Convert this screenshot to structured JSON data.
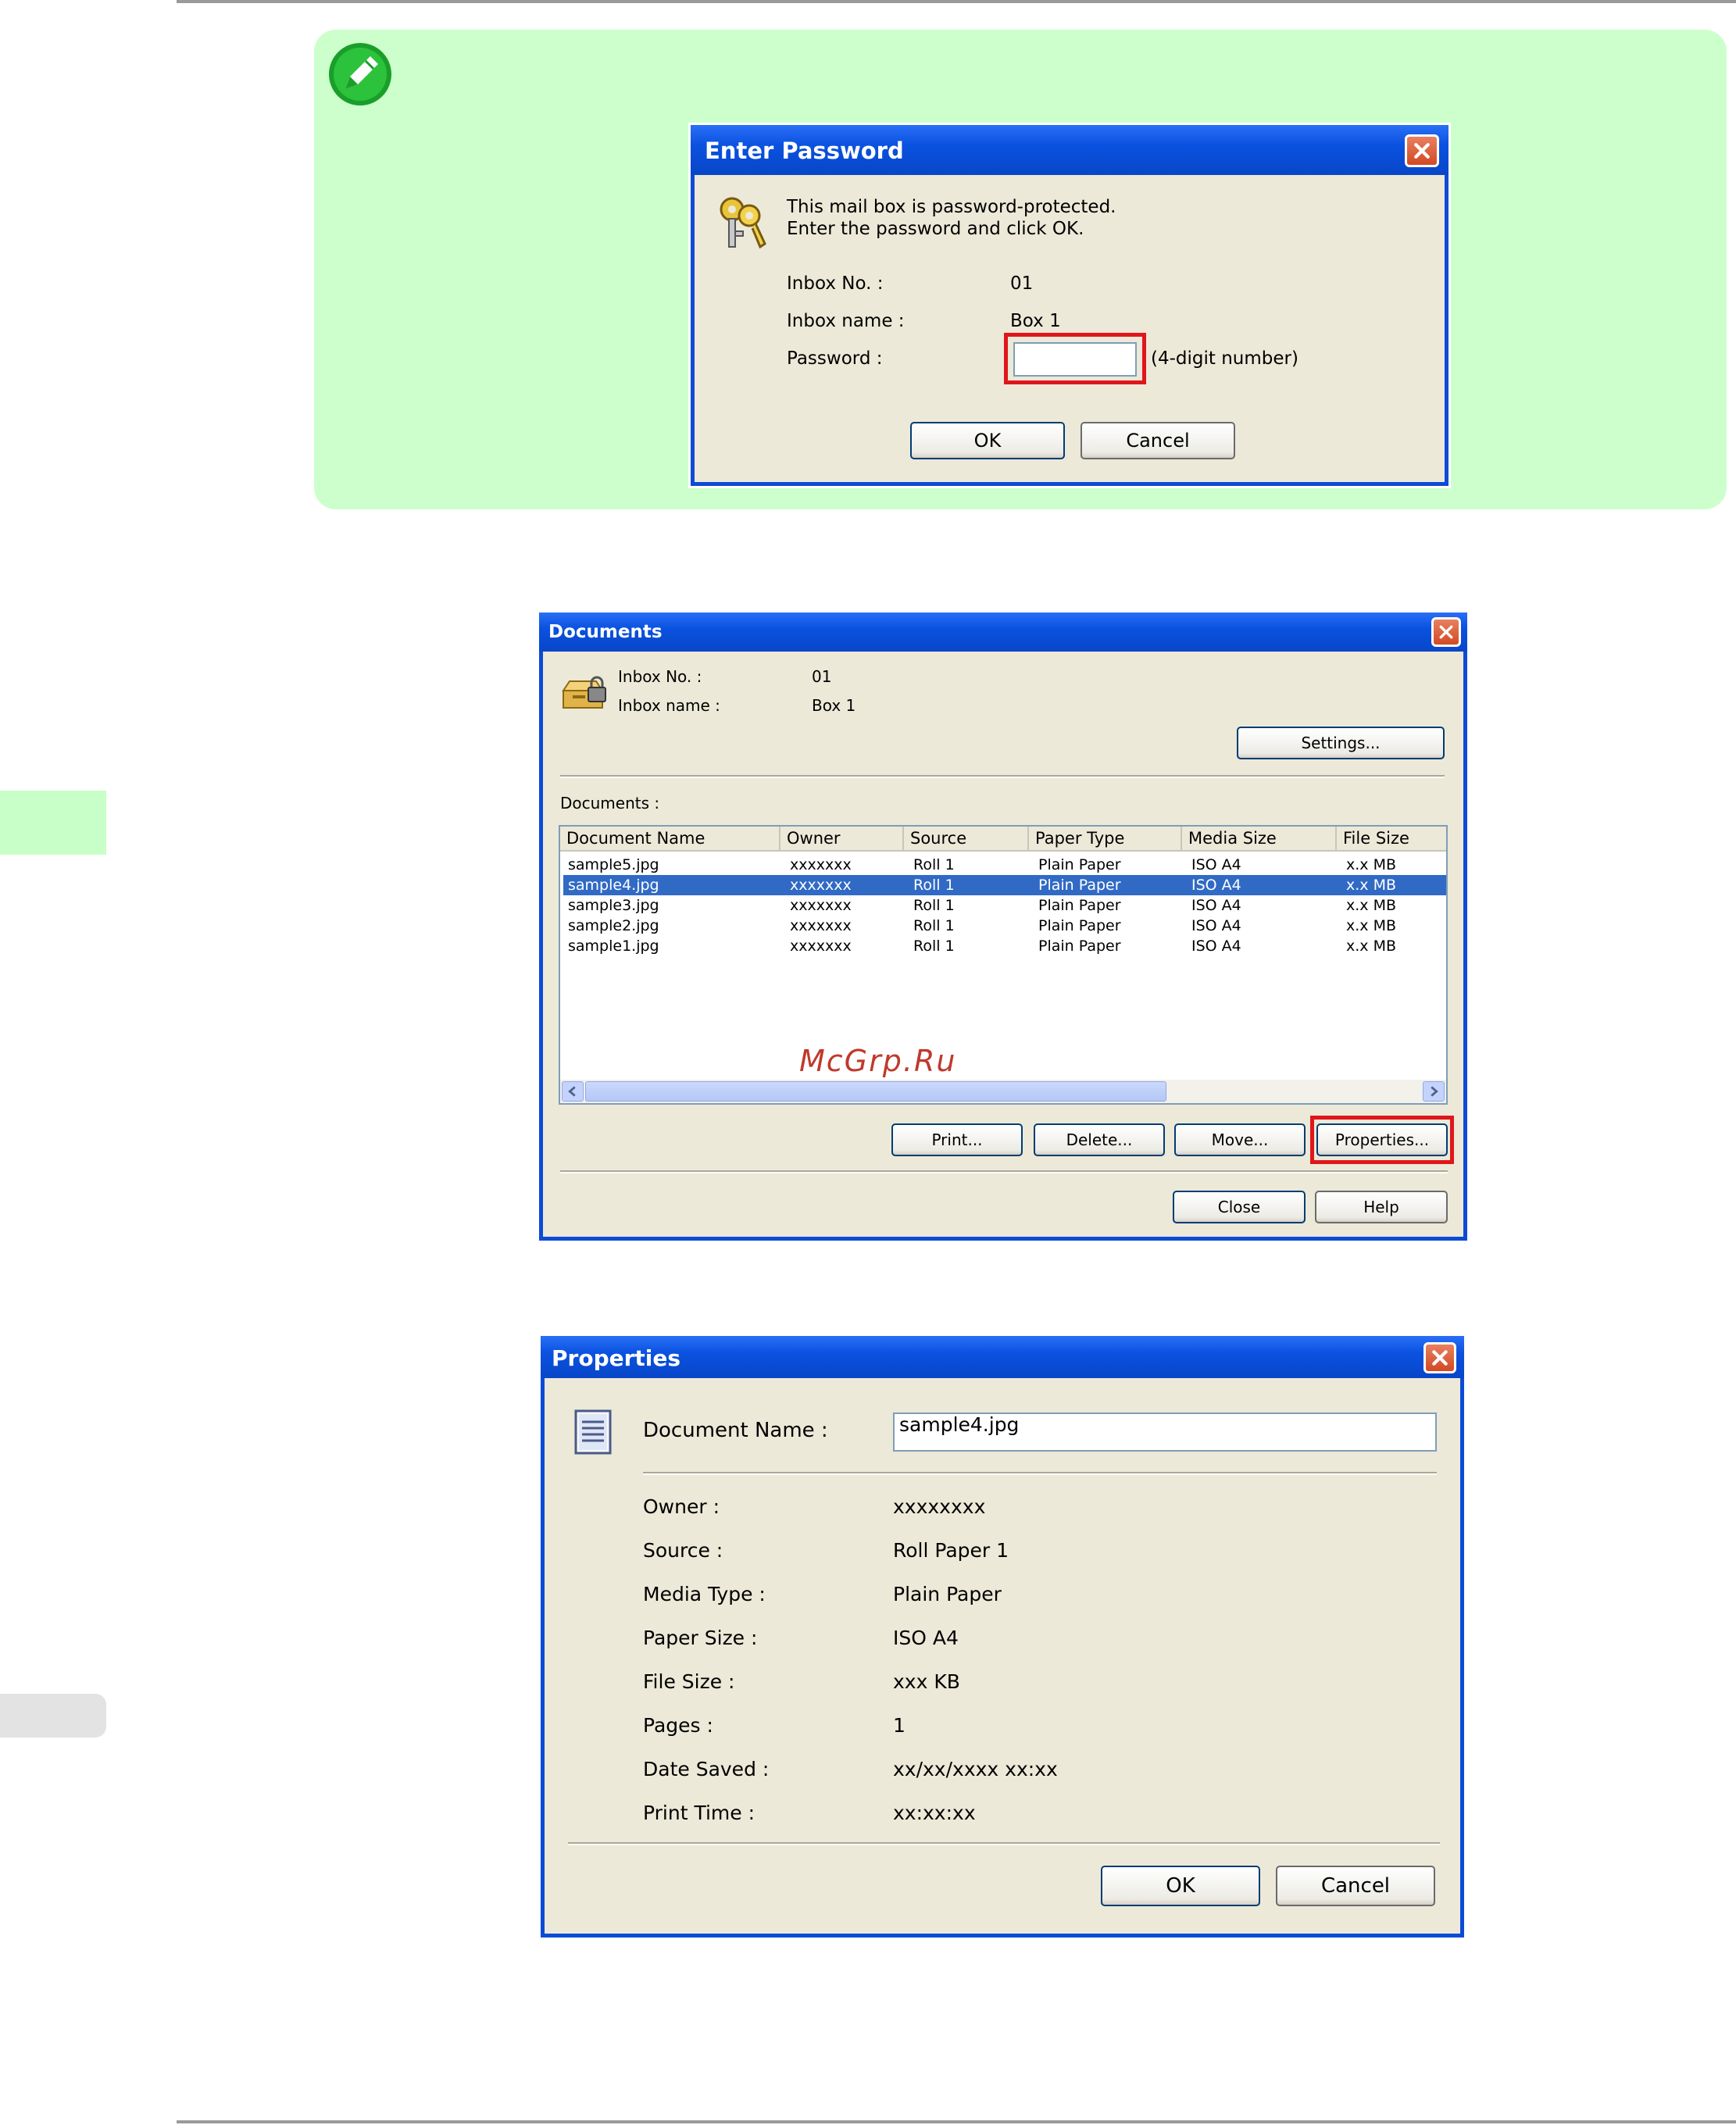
{
  "note_icon": "pencil-note-icon",
  "enter_password": {
    "title": "Enter Password",
    "icon": "keys-icon",
    "message_line1": "This mail box is password-protected.",
    "message_line2": "Enter the password and click OK.",
    "inbox_no_label": "Inbox No. :",
    "inbox_no_value": "01",
    "inbox_name_label": "Inbox name :",
    "inbox_name_value": "Box 1",
    "password_label": "Password :",
    "password_value": "",
    "password_hint": "(4-digit number)",
    "ok_label": "OK",
    "cancel_label": "Cancel"
  },
  "documents": {
    "title": "Documents",
    "icon": "mailbox-lock-icon",
    "inbox_no_label": "Inbox No. :",
    "inbox_no_value": "01",
    "inbox_name_label": "Inbox name :",
    "inbox_name_value": "Box 1",
    "settings_label": "Settings...",
    "list_label": "Documents :",
    "columns": [
      "Document Name",
      "Owner",
      "Source",
      "Paper Type",
      "Media Size",
      "File Size"
    ],
    "rows": [
      [
        "sample5.jpg",
        "xxxxxxx",
        "Roll 1",
        "Plain Paper",
        "ISO A4",
        "x.x MB"
      ],
      [
        "sample4.jpg",
        "xxxxxxx",
        "Roll 1",
        "Plain Paper",
        "ISO A4",
        "x.x MB"
      ],
      [
        "sample3.jpg",
        "xxxxxxx",
        "Roll 1",
        "Plain Paper",
        "ISO A4",
        "x.x MB"
      ],
      [
        "sample2.jpg",
        "xxxxxxx",
        "Roll 1",
        "Plain Paper",
        "ISO A4",
        "x.x MB"
      ],
      [
        "sample1.jpg",
        "xxxxxxx",
        "Roll 1",
        "Plain Paper",
        "ISO A4",
        "x.x MB"
      ]
    ],
    "selected_row": 1,
    "watermark": "McGrp.Ru",
    "print_label": "Print...",
    "delete_label": "Delete...",
    "move_label": "Move...",
    "properties_label": "Properties...",
    "close_label": "Close",
    "help_label": "Help"
  },
  "properties": {
    "title": "Properties",
    "icon": "document-icon",
    "document_name_label": "Document Name :",
    "document_name_value": "sample4.jpg",
    "fields": [
      {
        "label": "Owner :",
        "value": "xxxxxxxx"
      },
      {
        "label": "Source :",
        "value": "Roll Paper 1"
      },
      {
        "label": "Media Type :",
        "value": "Plain Paper"
      },
      {
        "label": "Paper Size :",
        "value": "ISO A4"
      },
      {
        "label": "File Size :",
        "value": "xxx KB"
      },
      {
        "label": "Pages :",
        "value": "1"
      },
      {
        "label": "Date Saved :",
        "value": "xx/xx/xxxx xx:xx"
      },
      {
        "label": "Print Time :",
        "value": "xx:xx:xx"
      }
    ],
    "ok_label": "OK",
    "cancel_label": "Cancel"
  }
}
